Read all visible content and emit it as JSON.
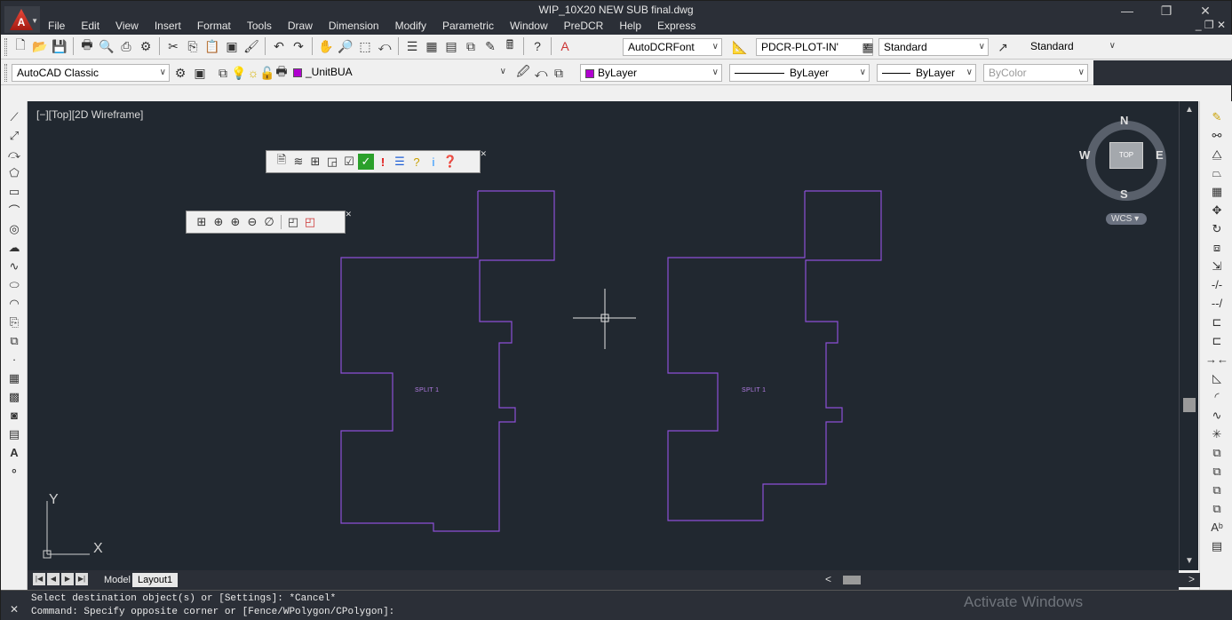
{
  "window": {
    "title": "WIP_10X20 NEW SUB final.dwg",
    "app_logo_letter": "A"
  },
  "menu": [
    "File",
    "Edit",
    "View",
    "Insert",
    "Format",
    "Tools",
    "Draw",
    "Dimension",
    "Modify",
    "Parametric",
    "Window",
    "PreDCR",
    "Help",
    "Express"
  ],
  "toolbar1": {
    "text_style": "AutoDCRFont",
    "dim_style": "PDCR-PLOT-IN'",
    "table_style": "Standard",
    "mleader_style": "Standard"
  },
  "toolbar2": {
    "workspace": "AutoCAD Classic",
    "layer": "_UnitBUA",
    "color": "ByLayer",
    "linetype": "ByLayer",
    "lineweight": "ByLayer",
    "plotstyle": "ByColor"
  },
  "viewport": {
    "label": "[−][Top][2D Wireframe]"
  },
  "viewcube": {
    "north": "N",
    "south": "S",
    "east": "E",
    "west": "W",
    "face": "TOP",
    "ucs_menu": "WCS"
  },
  "drawing": {
    "labels": [
      "SPLIT 1",
      "SPLIT 1"
    ],
    "ucs_x": "X",
    "ucs_y": "Y",
    "line_color": "#8c4fd6",
    "background": "#212830"
  },
  "tabs": {
    "model": "Model",
    "layout": "Layout1"
  },
  "command": {
    "line1": "Select destination object(s) or [Settings]: *Cancel*",
    "line2": "Command: Specify opposite corner or [Fence/WPolygon/CPolygon]:"
  },
  "watermark": "Activate Windows"
}
